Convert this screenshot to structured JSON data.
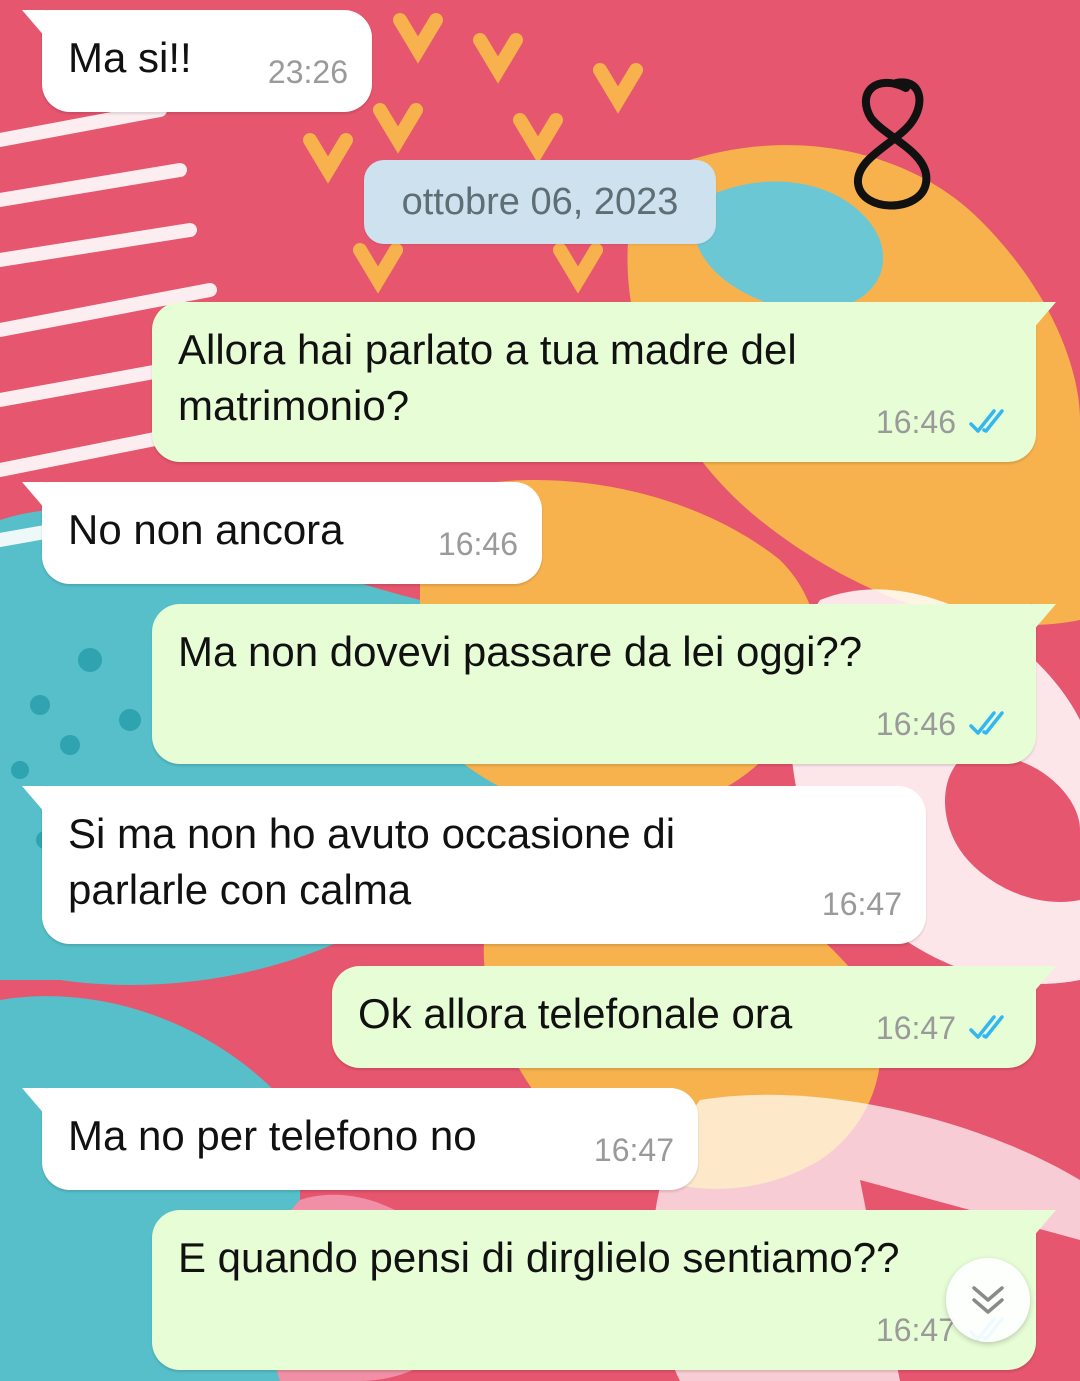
{
  "date_separator": "ottobre 06, 2023",
  "annotation": "8",
  "messages": [
    {
      "direction": "incoming",
      "text": "Ma si!!",
      "time": "23:26"
    },
    {
      "direction": "outgoing",
      "text": "Allora hai parlato a tua madre del\nmatrimonio?",
      "time": "16:46",
      "status": "read"
    },
    {
      "direction": "incoming",
      "text": "No non ancora",
      "time": "16:46"
    },
    {
      "direction": "outgoing",
      "text": "Ma non dovevi passare da lei oggi??",
      "time": "16:46",
      "status": "read"
    },
    {
      "direction": "incoming",
      "text": "Si ma non ho avuto occasione di\nparlarle con calma",
      "time": "16:47"
    },
    {
      "direction": "outgoing",
      "text": "Ok allora telefonale ora",
      "time": "16:47",
      "status": "read"
    },
    {
      "direction": "incoming",
      "text": "Ma no per telefono no",
      "time": "16:47"
    },
    {
      "direction": "outgoing",
      "text": "E quando pensi di dirglielo sentiamo??",
      "time": "16:47",
      "status": "read"
    }
  ],
  "icons": {
    "read_receipt": "double-check-icon",
    "scroll_down": "double-chevron-down-icon"
  },
  "colors": {
    "incoming_bubble": "#ffffff",
    "outgoing_bubble": "#e7fdd6",
    "date_chip": "#cde2ee",
    "read_tick": "#34b7f1"
  }
}
